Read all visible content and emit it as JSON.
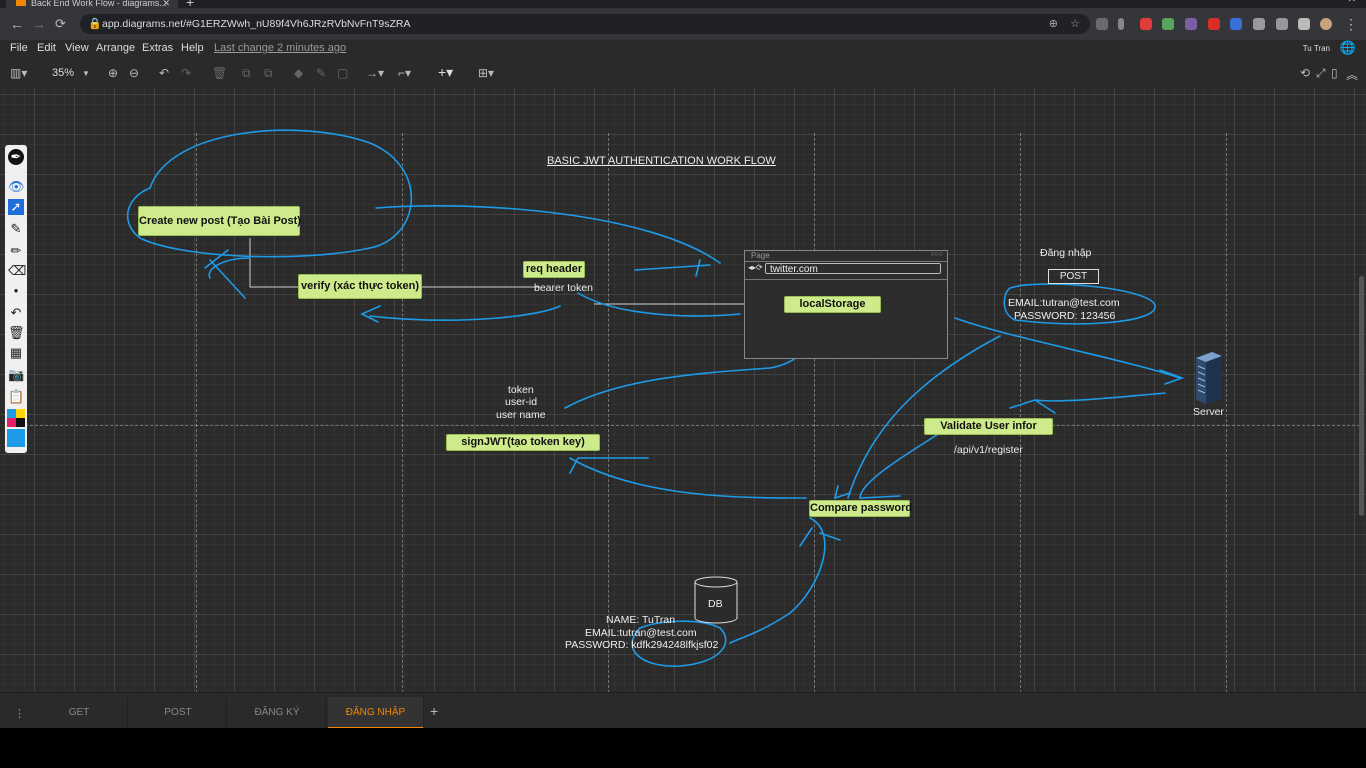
{
  "browser": {
    "tab_title": "Back End Work Flow - diagrams...",
    "url": "app.diagrams.net/#G1ERZWwh_nU89f4Vh6JRzRVbNvFnT9sZRA"
  },
  "menu": {
    "items": [
      "File",
      "Edit",
      "View",
      "Arrange",
      "Extras",
      "Help"
    ],
    "last_change": "Last change 2 minutes ago",
    "user": "Tu Tran"
  },
  "toolbar": {
    "zoom": "35%"
  },
  "diagram": {
    "title": "BASIC JWT AUTHENTICATION WORK FLOW",
    "nodes": {
      "create_post": "Create new post (Tạo Bài Post)",
      "verify": "verify (xác thực token)",
      "req_header": "req header",
      "local_storage": "localStorage",
      "sign_jwt": "signJWT(tạo token key)",
      "validate": "Validate User infor",
      "compare": "Compare password"
    },
    "labels": {
      "bearer": "bearer token",
      "token": "token",
      "user_id": "user-id",
      "user_name": "user name",
      "dang_nhap": "Đăng nhập",
      "email": "EMAIL:tutran@test.com",
      "password": "PASSWORD: 123456",
      "server": "Server",
      "api": "/api/v1/register",
      "db": "DB",
      "db_name": "NAME: TuTran",
      "db_email": "EMAIL:tutran@test.com",
      "db_password": "PASSWORD: kdfk294248lfkjsf02"
    },
    "browser_mock": {
      "page": "Page",
      "url": "twitter.com"
    },
    "post_button": "POST"
  },
  "pages": [
    "GET",
    "POST",
    "ĐĂNG KÝ",
    "ĐĂNG NHẬP"
  ],
  "active_page": "ĐĂNG NHẬP",
  "colors": {
    "node_fill": "#cdeb8b",
    "annotation": "#1e9be8",
    "accent": "#f08705"
  }
}
